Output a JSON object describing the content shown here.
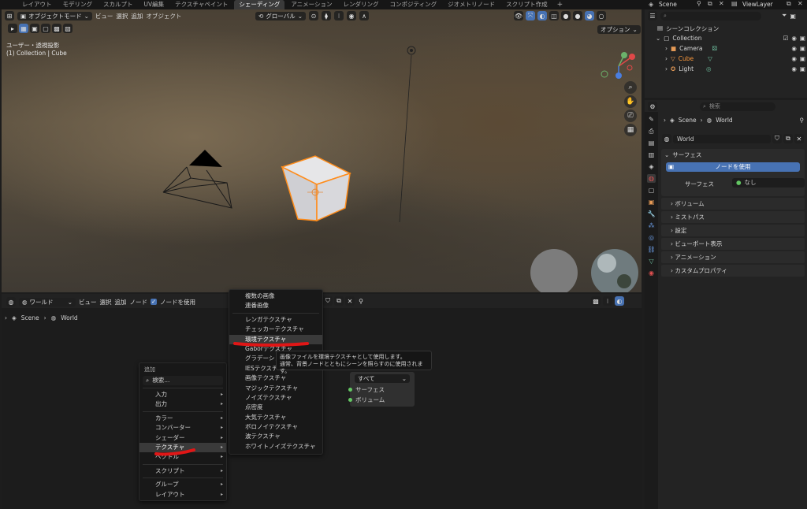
{
  "top_tabs": [
    "レイアウト",
    "モデリング",
    "スカルプト",
    "UV編集",
    "テクスチャペイント",
    "シェーディング",
    "アニメーション",
    "レンダリング",
    "コンポジティング",
    "ジオメトリノード",
    "スクリプト作成"
  ],
  "active_tab": "シェーディング",
  "tab_plus": "+",
  "scene_name": "Scene",
  "view_layer": "ViewLayer",
  "viewport": {
    "mode": "オブジェクトモード",
    "menu": [
      "ビュー",
      "選択",
      "追加",
      "オブジェクト"
    ],
    "transform": "グローバル",
    "options": "オプション",
    "info_line1": "ユーザー・透視投影",
    "info_line2": "(1) Collection | Cube"
  },
  "outliner": {
    "root": "シーンコレクション",
    "collection": "Collection",
    "items": [
      "Camera",
      "Cube",
      "Light"
    ]
  },
  "properties": {
    "search_placeholder": "検索",
    "breadcrumb_scene": "Scene",
    "breadcrumb_world": "World",
    "world_name": "World",
    "surface_panel": "サーフェス",
    "use_nodes": "ノードを使用",
    "surface_label": "サーフェス",
    "surface_value": "なし",
    "panels": [
      "ボリューム",
      "ミストパス",
      "設定",
      "ビューポート表示",
      "アニメーション",
      "カスタムプロパティ"
    ]
  },
  "node_editor": {
    "world_select": "ワールド",
    "menu": [
      "ビュー",
      "選択",
      "追加",
      "ノード"
    ],
    "use_nodes": "ノードを使用",
    "breadcrumb_scene": "Scene",
    "breadcrumb_world": "World"
  },
  "add_menu": {
    "title": "追加",
    "search": "検索...",
    "items": [
      "入力",
      "出力",
      "カラー",
      "コンバーター",
      "シェーダー",
      "テクスチャ",
      "ベクトル",
      "スクリプト",
      "グループ",
      "レイアウト"
    ]
  },
  "texture_menu": {
    "items": [
      "複数の画像",
      "連番画像",
      "レンガテクスチャ",
      "チェッカーテクスチャ",
      "環境テクスチャ",
      "Gaborテクスチャ",
      "グラデーションテクスチャ",
      "IESテクスチャ",
      "画像テクスチャ",
      "マジックテクスチャ",
      "ノイズテクスチャ",
      "点密度",
      "大気テクスチャ",
      "ボロノイテクスチャ",
      "波テクスチャ",
      "ホワイトノイズテクスチャ"
    ],
    "highlighted": "環境テクスチャ"
  },
  "tooltip": {
    "line1": "画像ファイルを環境テクスチャとして使用します。",
    "line2": "通常、背景ノードとともにシーンを照らすのに使用されます。"
  },
  "output_node": {
    "target": "すべて",
    "sockets": [
      "サーフェス",
      "ボリューム"
    ]
  },
  "colors": {
    "accent_blue": "#4772b3",
    "selection_orange": "#ff8c1a",
    "annotation_red": "#e01616"
  }
}
